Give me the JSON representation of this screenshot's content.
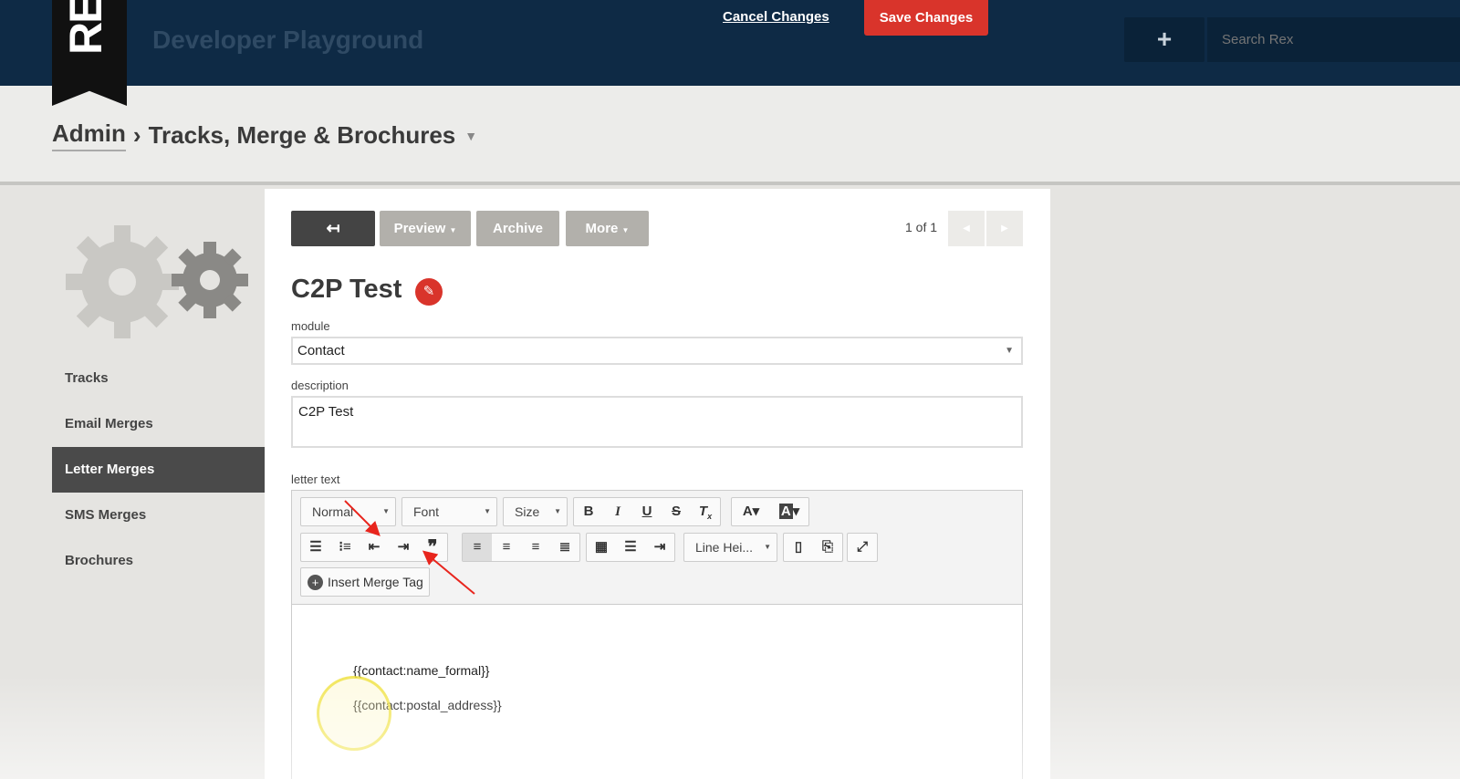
{
  "app": {
    "logo_text": "REX",
    "title": "Developer Playground",
    "cancel_label": "Cancel Changes",
    "save_label": "Save Changes",
    "add_icon": "+",
    "search_placeholder": "Search Rex"
  },
  "breadcrumb": {
    "root": "Admin",
    "separator": "›",
    "current": "Tracks, Merge & Brochures"
  },
  "sidebar": {
    "items": [
      {
        "label": "Tracks"
      },
      {
        "label": "Email Merges"
      },
      {
        "label": "Letter Merges",
        "active": true
      },
      {
        "label": "SMS Merges"
      },
      {
        "label": "Brochures"
      }
    ]
  },
  "toolbar": {
    "back_icon": "↤",
    "preview_label": "Preview",
    "archive_label": "Archive",
    "more_label": "More",
    "pager": "1 of 1"
  },
  "record": {
    "title": "C2P Test",
    "module_label": "module",
    "module_value": "Contact",
    "description_label": "description",
    "description_value": "C2P Test",
    "letter_label": "letter text"
  },
  "editor": {
    "format_drop": "Normal",
    "font_drop": "Font",
    "size_drop": "Size",
    "line_height_drop": "Line Hei...",
    "insert_merge_label": "Insert Merge Tag",
    "lines": [
      "{{contact:name_formal}}",
      "{{contact:postal_address}}"
    ]
  },
  "colors": {
    "topbar": "#0e2a45",
    "save": "#d9342b",
    "active_nav": "#4a4a4a"
  }
}
